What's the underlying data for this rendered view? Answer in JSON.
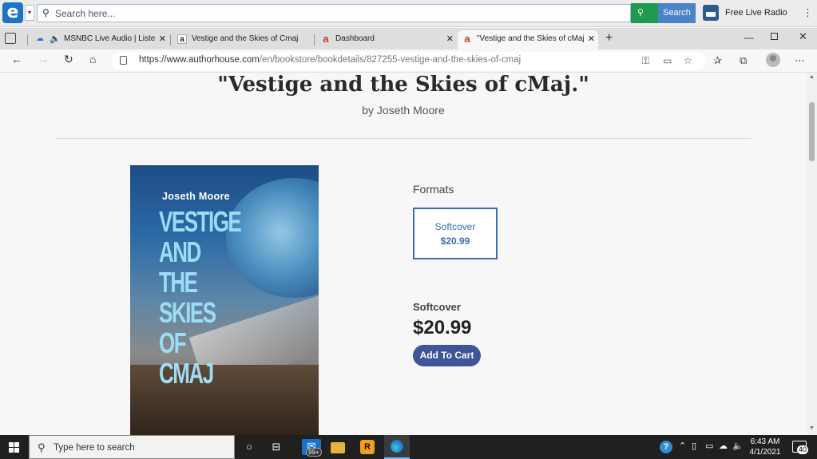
{
  "toolbar": {
    "search_placeholder": "Search here...",
    "search_button": "Search",
    "radio_label": "Free Live Radio"
  },
  "tabs": [
    {
      "title": "MSNBC Live Audio | Listen t",
      "favicon": "cloud-icon"
    },
    {
      "title": "Vestige and the Skies of Cmaj: N",
      "favicon": "amazon-icon"
    },
    {
      "title": "Dashboard",
      "favicon": "authorhouse-icon"
    },
    {
      "title": "\"Vestige and the Skies of cMaj.\" |",
      "favicon": "authorhouse-icon",
      "active": true
    }
  ],
  "address": {
    "url_host": "https://www.authorhouse.com",
    "url_path": "/en/bookstore/bookdetails/827255-vestige-and-the-skies-of-cmaj"
  },
  "book": {
    "title": "\"Vestige and the Skies of cMaj.\"",
    "author_line": "by Joseth Moore",
    "cover_author": "Joseth Moore",
    "cover_title": "VESTIGE\nAND THE\nSKIES OF\nCMAJ"
  },
  "formats": {
    "label": "Formats",
    "options": [
      {
        "name": "Softcover",
        "price": "$20.99"
      }
    ]
  },
  "selection": {
    "format": "Softcover",
    "price": "$20.99",
    "add_to_cart": "Add To Cart"
  },
  "taskbar": {
    "search_placeholder": "Type here to search",
    "mail_badge": "99+",
    "time": "6:43 AM",
    "date": "4/1/2021",
    "notification_count": "40"
  },
  "colors": {
    "accent": "#3d6bb3",
    "button": "#3e5597",
    "search_green": "#1e9b4e"
  }
}
